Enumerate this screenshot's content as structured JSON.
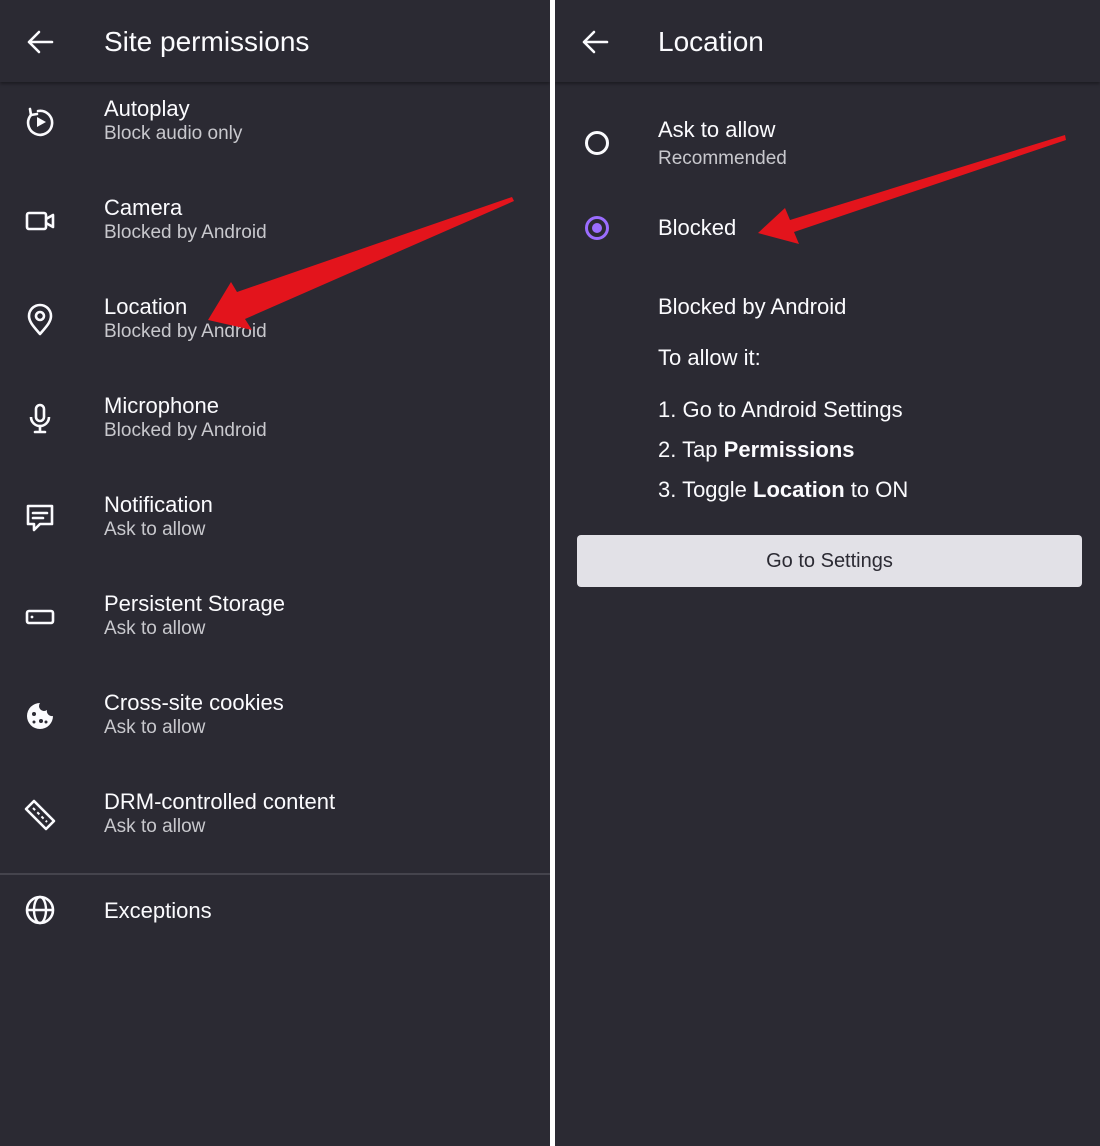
{
  "left": {
    "title": "Site permissions",
    "items": [
      {
        "title": "Autoplay",
        "subtitle": "Block audio only",
        "icon": "autoplay-icon"
      },
      {
        "title": "Camera",
        "subtitle": "Blocked by Android",
        "icon": "camera-icon"
      },
      {
        "title": "Location",
        "subtitle": "Blocked by Android",
        "icon": "location-pin-icon"
      },
      {
        "title": "Microphone",
        "subtitle": "Blocked by Android",
        "icon": "microphone-icon"
      },
      {
        "title": "Notification",
        "subtitle": "Ask to allow",
        "icon": "notification-icon"
      },
      {
        "title": "Persistent Storage",
        "subtitle": "Ask to allow",
        "icon": "storage-icon"
      },
      {
        "title": "Cross-site cookies",
        "subtitle": "Ask to allow",
        "icon": "cookie-icon"
      },
      {
        "title": "DRM-controlled content",
        "subtitle": "Ask to allow",
        "icon": "drm-icon"
      }
    ],
    "exceptions": {
      "title": "Exceptions",
      "icon": "globe-icon"
    }
  },
  "right": {
    "title": "Location",
    "options": [
      {
        "label": "Ask to allow",
        "sublabel": "Recommended",
        "selected": false
      },
      {
        "label": "Blocked",
        "selected": true
      }
    ],
    "blocked_note": "Blocked by Android",
    "to_allow": "To allow it:",
    "steps": {
      "step1": "1. Go to Android Settings",
      "step2_prefix": "2. Tap ",
      "step2_bold": "Permissions",
      "step3_prefix": "3. Toggle ",
      "step3_bold": "Location",
      "step3_suffix": " to ON"
    },
    "button_label": "Go to Settings"
  },
  "colors": {
    "background": "#2b2a33",
    "accent": "#9b6dff",
    "annotation_arrow": "#e3141c",
    "button": "#e2e1e7"
  }
}
